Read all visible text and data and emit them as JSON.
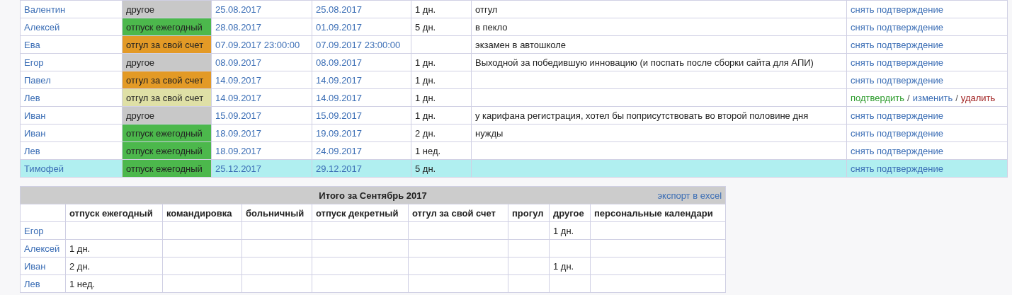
{
  "absences": {
    "rows": [
      {
        "name": "Валентин",
        "type": "другое",
        "color": "#c8c8c8",
        "start": "25.08.2017",
        "end": "25.08.2017",
        "duration": "1 дн.",
        "comment": "отгул",
        "highlighted": false,
        "actions": [
          {
            "kind": "unconfirm",
            "label": "снять подтверждение"
          }
        ]
      },
      {
        "name": "Алексей",
        "type": "отпуск ежегодный",
        "color": "#4cb84c",
        "start": "28.08.2017",
        "end": "01.09.2017",
        "duration": "5 дн.",
        "comment": "в пекло",
        "highlighted": false,
        "actions": [
          {
            "kind": "unconfirm",
            "label": "снять подтверждение"
          }
        ]
      },
      {
        "name": "Ева",
        "type": "отгул за свой счет",
        "color": "#e39a26",
        "start": "07.09.2017 23:00:00",
        "end": "07.09.2017 23:00:00",
        "comment": "экзамен в автошколе",
        "highlighted": false,
        "actions": [
          {
            "kind": "unconfirm",
            "label": "снять подтверждение"
          }
        ]
      },
      {
        "name": "Егор",
        "type": "другое",
        "color": "#c8c8c8",
        "start": "08.09.2017",
        "end": "08.09.2017",
        "duration": "1 дн.",
        "comment": "Выходной за победившую инновацию (и поспать после сборки сайта для АПИ)",
        "highlighted": false,
        "actions": [
          {
            "kind": "unconfirm",
            "label": "снять подтверждение"
          }
        ]
      },
      {
        "name": "Павел",
        "type": "отгул за свой счет",
        "color": "#e39a26",
        "start": "14.09.2017",
        "end": "14.09.2017",
        "duration": "1 дн.",
        "highlighted": false,
        "actions": [
          {
            "kind": "unconfirm",
            "label": "снять подтверждение"
          }
        ]
      },
      {
        "name": "Лев",
        "type": "отгул за свой счет",
        "color": "#dfe0a6",
        "start": "14.09.2017",
        "end": "14.09.2017",
        "duration": "1 дн.",
        "highlighted": false,
        "actions": [
          {
            "kind": "confirm",
            "label": "подтвердить"
          },
          {
            "kind": "separator",
            "label": "/"
          },
          {
            "kind": "edit",
            "label": "изменить"
          },
          {
            "kind": "separator",
            "label": "/"
          },
          {
            "kind": "delete",
            "label": "удалить"
          }
        ]
      },
      {
        "name": "Иван",
        "type": "другое",
        "color": "#c8c8c8",
        "start": "15.09.2017",
        "end": "15.09.2017",
        "duration": "1 дн.",
        "comment": "у карифана регистрация, хотел бы поприсутствовать во второй половине дня",
        "highlighted": false,
        "actions": [
          {
            "kind": "unconfirm",
            "label": "снять подтверждение"
          }
        ]
      },
      {
        "name": "Иван",
        "type": "отпуск ежегодный",
        "color": "#4cb84c",
        "start": "18.09.2017",
        "end": "19.09.2017",
        "duration": "2 дн.",
        "comment": "нужды",
        "highlighted": false,
        "actions": [
          {
            "kind": "unconfirm",
            "label": "снять подтверждение"
          }
        ]
      },
      {
        "name": "Лев",
        "type": "отпуск ежегодный",
        "color": "#4cb84c",
        "start": "18.09.2017",
        "end": "24.09.2017",
        "duration": "1 нед.",
        "highlighted": false,
        "actions": [
          {
            "kind": "unconfirm",
            "label": "снять подтверждение"
          }
        ]
      },
      {
        "name": "Тимофей",
        "type": "отпуск ежегодный",
        "color": "#4cb84c",
        "start": "25.12.2017",
        "end": "29.12.2017",
        "duration": "5 дн.",
        "highlighted": true,
        "actions": [
          {
            "kind": "unconfirm",
            "label": "снять подтверждение"
          }
        ]
      }
    ]
  },
  "summary": {
    "title": "Итого за Сентябрь 2017",
    "export_link": "экспорт в excel",
    "columns": [
      "отпуск ежегодный",
      "командировка",
      "больничный",
      "отпуск декретный",
      "отгул за свой счет",
      "прогул",
      "другое",
      "персональные календари"
    ],
    "rows": [
      {
        "name": "Егор",
        "cells": [
          null,
          null,
          null,
          null,
          null,
          null,
          "1 дн.",
          null
        ]
      },
      {
        "name": "Алексей",
        "cells": [
          "1 дн.",
          null,
          null,
          null,
          null,
          null,
          null,
          null
        ]
      },
      {
        "name": "Иван",
        "cells": [
          "2 дн.",
          null,
          null,
          null,
          null,
          null,
          "1 дн.",
          null
        ]
      },
      {
        "name": "Лев",
        "cells": [
          "1 нед.",
          null,
          null,
          null,
          null,
          null,
          null,
          null
        ]
      }
    ]
  }
}
